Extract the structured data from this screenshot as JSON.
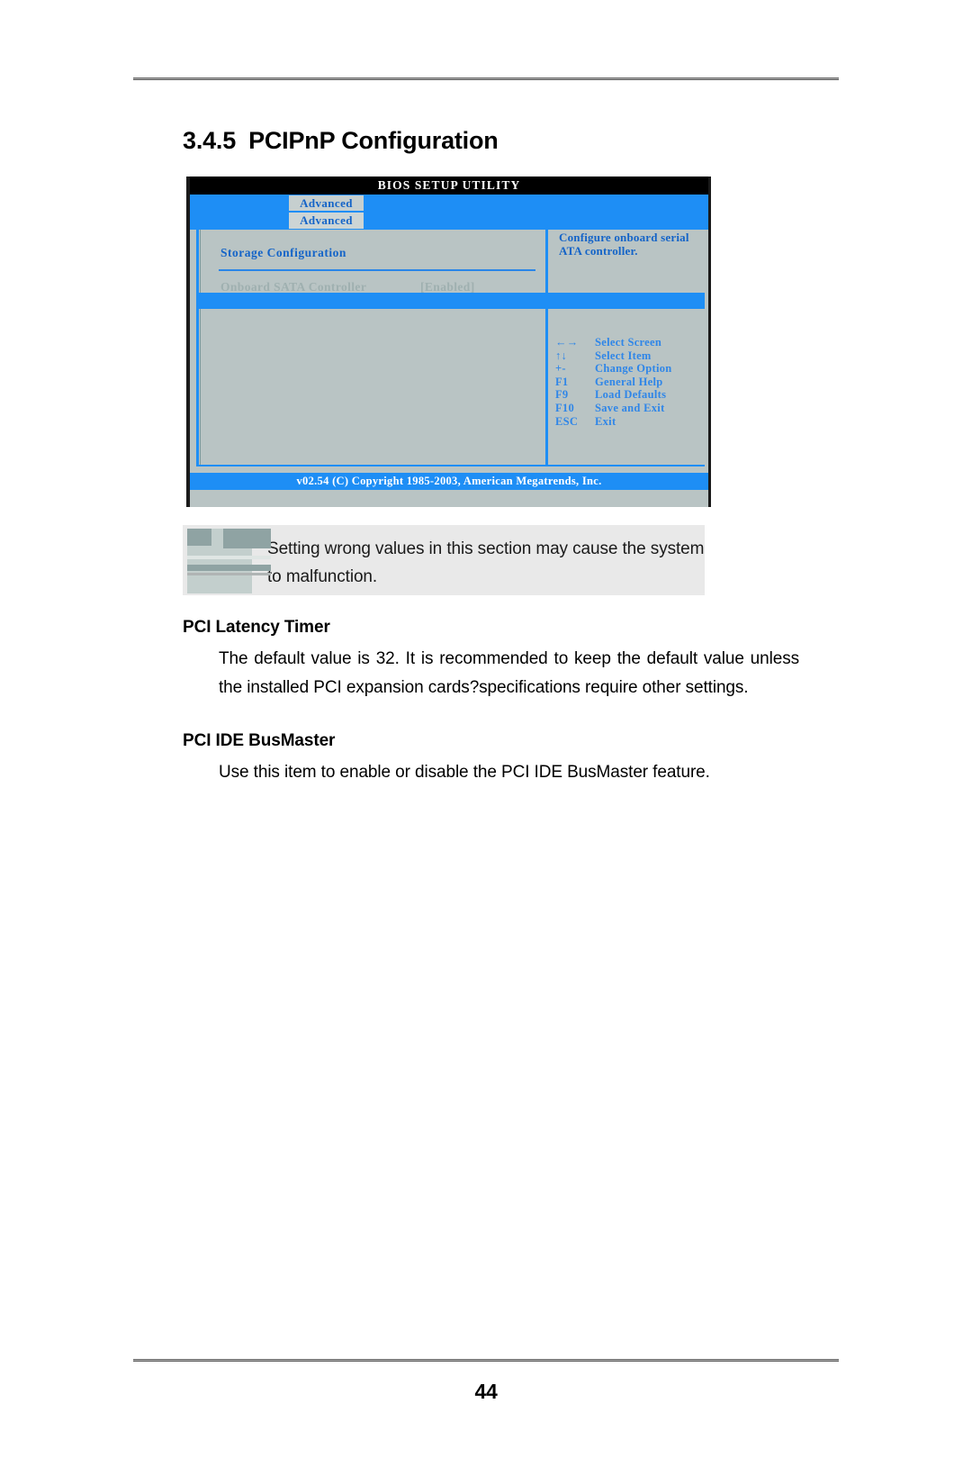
{
  "page": {
    "number": "44"
  },
  "section": {
    "number": "3.4.5",
    "title": "PCIPnP Configuration"
  },
  "bios": {
    "title": "BIOS SETUP UTILITY",
    "tab_primary": "Advanced",
    "tab_secondary": "Advanced",
    "group_heading": "Storage Configuration",
    "row": {
      "label": "Onboard SATA Controller",
      "value": "[Enabled]"
    },
    "help_text": "Configure onboard serial ATA controller.",
    "keys": [
      {
        "key": "←→",
        "action": "Select Screen"
      },
      {
        "key": "↑↓",
        "action": "Select Item"
      },
      {
        "key": "+-",
        "action": "Change Option"
      },
      {
        "key": "F1",
        "action": "General Help"
      },
      {
        "key": "F9",
        "action": "Load Defaults"
      },
      {
        "key": "F10",
        "action": "Save and Exit"
      },
      {
        "key": "ESC",
        "action": "Exit"
      }
    ],
    "copyright": "v02.54 (C) Copyright 1985-2003, American Megatrends, Inc.",
    "colors": {
      "accent_blue": "#1e8ef5",
      "panel_gray": "#b9c4c4",
      "text_blue": "#1464c8",
      "title_bar": "#000000"
    }
  },
  "note": {
    "text": "Setting wrong values in this section may cause the system to malfunction."
  },
  "sections": {
    "latency": {
      "heading": "PCI Latency Timer",
      "body": "The default value is 32. It is recommended to keep the default value unless the installed PCI expansion cards?specifications require other settings."
    },
    "busmaster": {
      "heading": "PCI IDE BusMaster",
      "body": "Use this item to enable or disable the PCI IDE BusMaster feature."
    }
  }
}
